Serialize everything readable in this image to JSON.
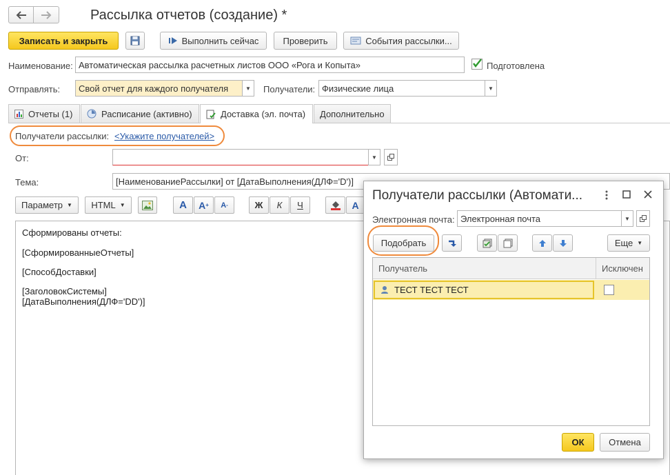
{
  "window": {
    "title": "Рассылка отчетов (создание) *"
  },
  "toolbar": {
    "save_close": "Записать и закрыть",
    "run_now": "Выполнить сейчас",
    "check": "Проверить",
    "events": "События рассылки..."
  },
  "form": {
    "name_label": "Наименование:",
    "name_value": "Автоматическая рассылка расчетных листов ООО «Рога и Копыта»",
    "prepared_label": "Подготовлена",
    "prepared_checked": true,
    "send_label": "Отправлять:",
    "send_value": "Свой отчет для каждого получателя",
    "recipients_label": "Получатели:",
    "recipients_value": "Физические лица"
  },
  "tabs": [
    {
      "label": "Отчеты (1)",
      "icon": "report-icon"
    },
    {
      "label": "Расписание (активно)",
      "icon": "schedule-icon"
    },
    {
      "label": "Доставка (эл. почта)",
      "icon": "delivery-icon",
      "active": true
    },
    {
      "label": "Дополнительно"
    }
  ],
  "delivery": {
    "recipients_label": "Получатели рассылки:",
    "recipients_link": "<Укажите получателей>",
    "from_label": "От:",
    "from_value": "",
    "subject_label": "Тема:",
    "subject_value": "[НаименованиеРассылки] от [ДатаВыполнения(ДЛФ='D')]"
  },
  "editor_toolbar": {
    "param": "Параметр",
    "html": "HTML",
    "bold": "Ж",
    "italic": "К",
    "underline": "Ч",
    "font_a": "A"
  },
  "editor_lines": [
    "Сформированы отчеты:",
    "[СформированныеОтчеты]",
    "[СпособДоставки]",
    "[ЗаголовокСистемы]",
    "[ДатаВыполнения(ДЛФ='DD')]"
  ],
  "dialog": {
    "title": "Получатели рассылки (Автомати...",
    "email_label": "Электронная почта:",
    "email_value": "Электронная почта",
    "pick_button": "Подобрать",
    "more_button": "Еще",
    "col_recipient": "Получатель",
    "col_excluded": "Исключен",
    "rows": [
      {
        "recipient": "ТЕСТ ТЕСТ ТЕСТ",
        "excluded": false
      }
    ],
    "ok": "ОК",
    "cancel": "Отмена"
  },
  "colors": {
    "accent_yellow": "#f5c81e",
    "highlight_oval": "#ef8a3c",
    "link_blue": "#2a5aa8",
    "row_selected": "#fbeeb0"
  }
}
